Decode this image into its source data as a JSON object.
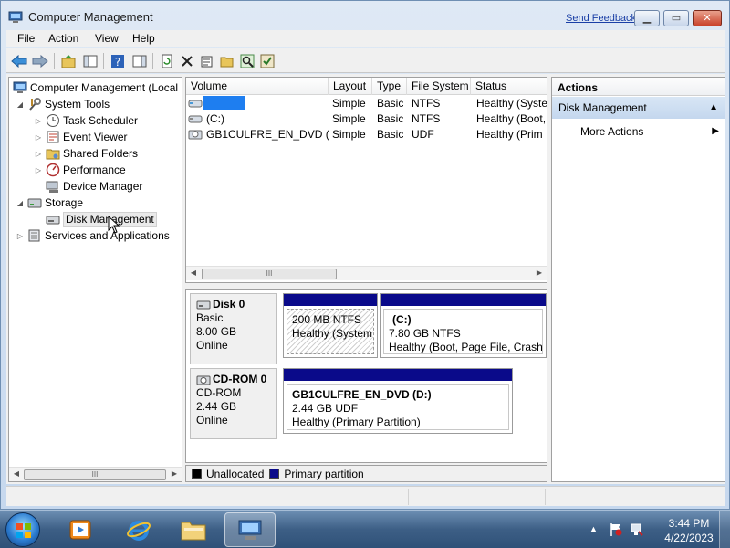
{
  "window": {
    "title": "Computer Management",
    "feedback_link": "Send Feedback"
  },
  "menu": [
    "File",
    "Action",
    "View",
    "Help"
  ],
  "tree": {
    "root": "Computer Management (Local",
    "system_tools": "System Tools",
    "task_scheduler": "Task Scheduler",
    "event_viewer": "Event Viewer",
    "shared_folders": "Shared Folders",
    "performance": "Performance",
    "device_manager": "Device Manager",
    "storage": "Storage",
    "disk_management": "Disk Management",
    "services": "Services and Applications"
  },
  "volumes": {
    "headers": [
      "Volume",
      "Layout",
      "Type",
      "File System",
      "Status"
    ],
    "rows": [
      {
        "volume": "",
        "layout": "Simple",
        "type": "Basic",
        "fs": "NTFS",
        "status": "Healthy (Syste"
      },
      {
        "volume": "(C:)",
        "layout": "Simple",
        "type": "Basic",
        "fs": "NTFS",
        "status": "Healthy (Boot,"
      },
      {
        "volume": "GB1CULFRE_EN_DVD (D:)",
        "layout": "Simple",
        "type": "Basic",
        "fs": "UDF",
        "status": "Healthy (Prim"
      }
    ]
  },
  "disks": [
    {
      "name": "Disk 0",
      "kind": "Basic",
      "size": "8.00 GB",
      "state": "Online",
      "partitions": [
        {
          "label": "",
          "size": "200 MB NTFS",
          "status": "Healthy (System,"
        },
        {
          "label": "(C:)",
          "size": "7.80 GB NTFS",
          "status": "Healthy (Boot, Page File, Crash"
        }
      ]
    },
    {
      "name": "CD-ROM 0",
      "kind": "CD-ROM",
      "size": "2.44 GB",
      "state": "Online",
      "partitions": [
        {
          "label": "GB1CULFRE_EN_DVD  (D:)",
          "size": "2.44 GB UDF",
          "status": "Healthy (Primary Partition)"
        }
      ]
    }
  ],
  "legend": {
    "unallocated": "Unallocated",
    "primary": "Primary partition"
  },
  "actions": {
    "header": "Actions",
    "section": "Disk Management",
    "more": "More Actions"
  },
  "scroll_grip": "III",
  "clock": {
    "time": "3:44 PM",
    "date": "4/22/2023"
  },
  "colors": {
    "primary_partition": "#0a0a8a",
    "unallocated": "#000000",
    "selection_redact": "#1e7ef0"
  }
}
